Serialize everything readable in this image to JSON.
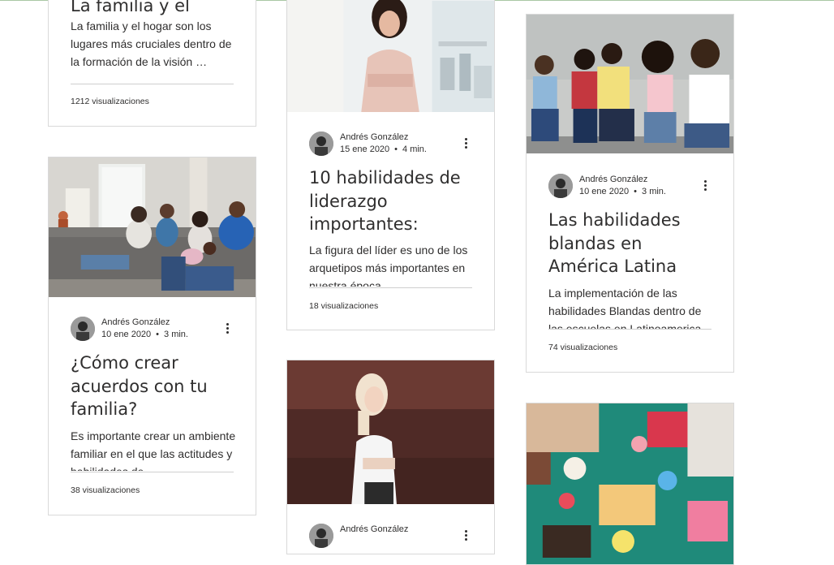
{
  "posts": [
    {
      "title": "La familia y el hogar",
      "excerpt": "La familia y el hogar son los lugares más cruciales dentro de la formación de la visión …",
      "views": "1212 visualizaciones"
    },
    {
      "author": "Andrés González",
      "date": "10 ene 2020",
      "read_time": "3 min.",
      "title": "¿Cómo crear acuerdos con tu familia?",
      "excerpt": "Es importante crear un ambiente familiar en el que las actitudes y habilidades de",
      "views": "38 visualizaciones"
    },
    {
      "author": "Andrés González",
      "date": "15 ene 2020",
      "read_time": "4 min.",
      "title": "10 habilidades de liderazgo importantes:",
      "excerpt": "La figura del líder es uno de los arquetipos más importantes en nuestra época",
      "views": "18 visualizaciones"
    },
    {
      "author": "Andrés González"
    },
    {
      "author": "Andrés González",
      "date": "10 ene 2020",
      "read_time": "3 min.",
      "title": "Las habilidades blandas en América Latina",
      "excerpt": "La implementación de las habilidades Blandas dentro de las escuelas en Latinoamerica",
      "views": "74 visualizaciones"
    }
  ],
  "colors": {
    "text": "#2f2e2e",
    "card_border": "#d9d9d9",
    "divider": "#cfcfcf",
    "top_rule": "#a9c7a4"
  },
  "icons": {
    "more": "more-options-icon",
    "avatar": "author-avatar"
  }
}
